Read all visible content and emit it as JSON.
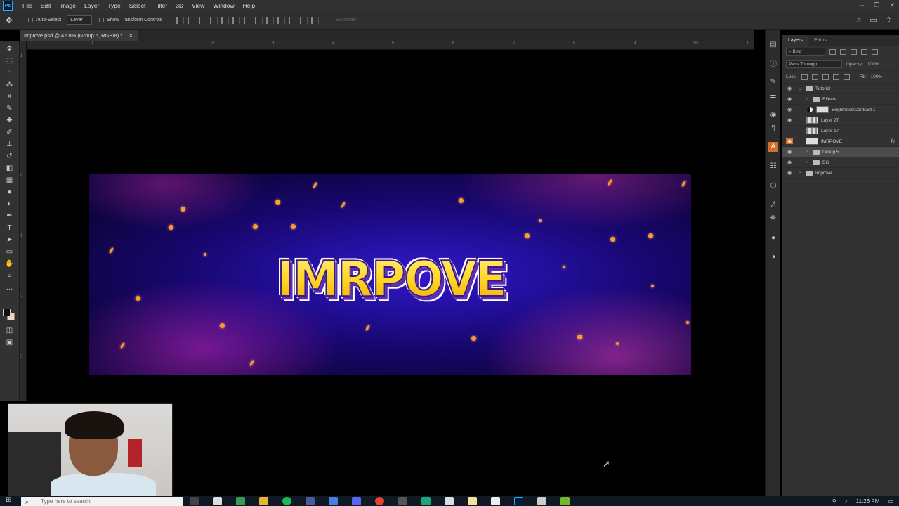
{
  "app": {
    "logo": "Ps",
    "menu": [
      "File",
      "Edit",
      "Image",
      "Layer",
      "Type",
      "Select",
      "Filter",
      "3D",
      "View",
      "Window",
      "Help"
    ]
  },
  "options": {
    "auto_select_label": "Auto-Select",
    "layer_select": "Layer",
    "transform_label": "Show Transform Controls",
    "mode_3d": "3D Mode:"
  },
  "document": {
    "tab_title": "Improve.psd @ 42.8% (Group 5, RGB/8) *",
    "close": "×"
  },
  "ruler": {
    "h_ticks": [
      "1",
      "0",
      "1",
      "2",
      "3",
      "4",
      "5",
      "6",
      "7",
      "8",
      "9",
      "10",
      "1"
    ],
    "v_ticks": [
      "1",
      "0",
      "1",
      "2",
      "3"
    ]
  },
  "canvas": {
    "banner_text": "IMRPOVE",
    "colors": {
      "bg_dark": "#120550",
      "bg_mid": "#3416c9",
      "accent": "#ff9a2e",
      "title": "#ffd21e"
    }
  },
  "layers_panel": {
    "tabs": [
      "Layers",
      "Paths"
    ],
    "filter_kind": "Kind",
    "blend_mode": "Pass Through",
    "opacity_label": "Opacity:",
    "opacity_value": "100%",
    "lock_label": "Lock:",
    "fill_label": "Fill:",
    "fill_value": "100%",
    "layers": [
      {
        "name": "Tutorial",
        "type": "group",
        "open": true,
        "visible": true,
        "depth": 0
      },
      {
        "name": "Effects",
        "type": "group",
        "open": false,
        "visible": true,
        "depth": 1
      },
      {
        "name": "Brightness/Contrast 1",
        "type": "adjustment",
        "visible": true,
        "depth": 1
      },
      {
        "name": "Layer 27",
        "type": "pixel",
        "visible": true,
        "depth": 1
      },
      {
        "name": "Layer 17",
        "type": "pixel",
        "visible": false,
        "depth": 1
      },
      {
        "name": "IMRPOVE",
        "type": "text-fx",
        "visible": true,
        "depth": 1,
        "fx": "fx"
      },
      {
        "name": "Group 5",
        "type": "group",
        "open": false,
        "visible": true,
        "depth": 1,
        "selected": true
      },
      {
        "name": "BG",
        "type": "group",
        "open": false,
        "visible": true,
        "depth": 1
      },
      {
        "name": "Improve",
        "type": "group",
        "open": false,
        "visible": true,
        "depth": 0
      }
    ]
  },
  "taskbar": {
    "search_placeholder": "Type here to search",
    "time": "11:26 PM"
  }
}
